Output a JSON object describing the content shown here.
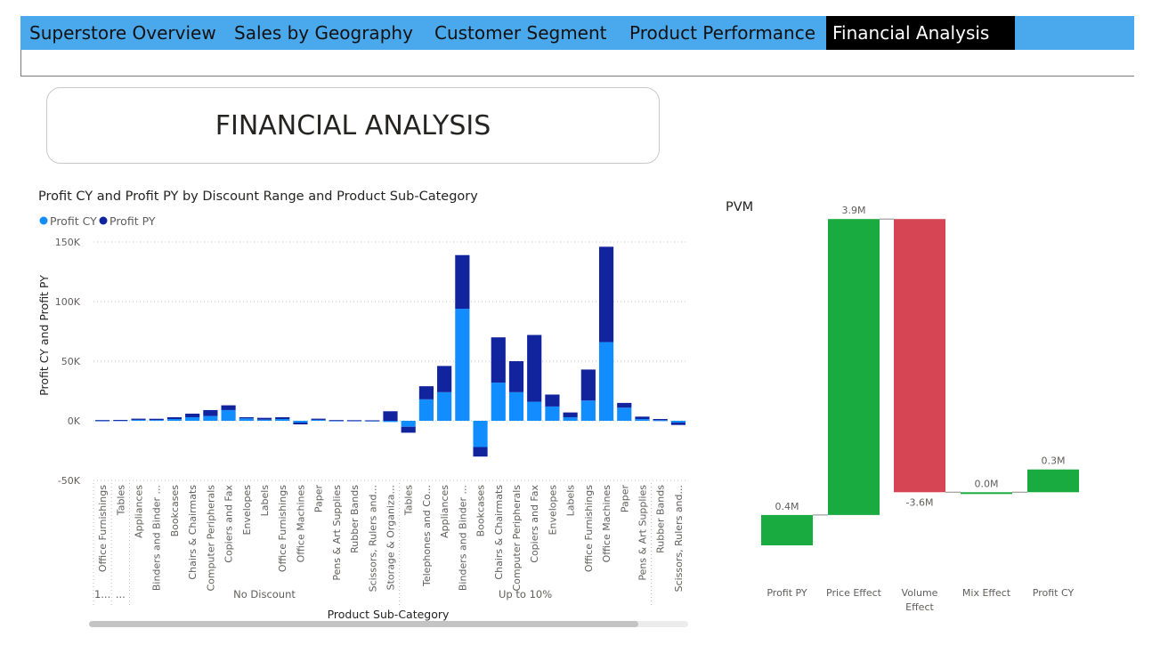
{
  "nav": {
    "tabs": [
      {
        "label": "Superstore Overview",
        "active": false
      },
      {
        "label": "Sales by Geography",
        "active": false
      },
      {
        "label": "Customer Segment",
        "active": false
      },
      {
        "label": "Product Performance",
        "active": false
      },
      {
        "label": "Financial Analysis",
        "active": true
      }
    ]
  },
  "page_title": "FINANCIAL ANALYSIS",
  "colors": {
    "nav_bg": "#4aa8ec",
    "profit_cy": "#118dff",
    "profit_py": "#12239e",
    "increase": "#1aab40",
    "decrease": "#d64554"
  },
  "chart_data": [
    {
      "type": "bar",
      "stacked": true,
      "title": "Profit CY and Profit PY by Discount Range and Product Sub-Category",
      "xlabel": "Product Sub-Category",
      "ylabel": "Profit CY and Profit PY",
      "ylim": [
        -50000,
        150000
      ],
      "yticks": [
        {
          "value": -50000,
          "label": "-50K"
        },
        {
          "value": 0,
          "label": "0K"
        },
        {
          "value": 50000,
          "label": "50K"
        },
        {
          "value": 100000,
          "label": "100K"
        },
        {
          "value": 150000,
          "label": "150K"
        }
      ],
      "grid": true,
      "legend_position": "top-left",
      "groups": [
        {
          "label": "1...",
          "count": 1
        },
        {
          "label": "...",
          "count": 1
        },
        {
          "label": "No Discount",
          "count": 15
        },
        {
          "label": "Up to 10%",
          "count": 14
        }
      ],
      "categories": [
        "Office Furnishings",
        "Tables",
        "Appliances",
        "Binders and Binder ...",
        "Bookcases",
        "Chairs & Chairmats",
        "Computer Peripherals",
        "Copiers and Fax",
        "Envelopes",
        "Labels",
        "Office Furnishings",
        "Office Machines",
        "Paper",
        "Pens & Art Supplies",
        "Rubber Bands",
        "Scissors, Rulers and...",
        "Storage & Organiza...",
        "Tables",
        "Telephones and Co...",
        "Appliances",
        "Binders and Binder ...",
        "Bookcases",
        "Chairs & Chairmats",
        "Computer Peripherals",
        "Copiers and Fax",
        "Envelopes",
        "Labels",
        "Office Furnishings",
        "Office Machines",
        "Paper",
        "Pens & Art Supplies",
        "Rubber Bands",
        "Scissors, Rulers and..."
      ],
      "series": [
        {
          "name": "Profit CY",
          "values": [
            300,
            500,
            800,
            700,
            1500,
            3000,
            4000,
            9000,
            2000,
            1000,
            1500,
            -1500,
            800,
            300,
            300,
            200,
            -1000,
            -5000,
            18000,
            24000,
            94000,
            -22000,
            32000,
            24000,
            16000,
            12000,
            3000,
            17000,
            66000,
            11000,
            1500,
            500,
            -1500
          ]
        },
        {
          "name": "Profit PY",
          "values": [
            300,
            200,
            1000,
            1000,
            1500,
            3000,
            5000,
            4000,
            1000,
            1500,
            1500,
            -1500,
            1000,
            300,
            200,
            200,
            8000,
            -5000,
            11000,
            22000,
            45000,
            -8000,
            38000,
            26000,
            56000,
            10000,
            4000,
            26000,
            80000,
            4000,
            2000,
            1000,
            -2000
          ]
        }
      ]
    },
    {
      "type": "bar",
      "subtype": "waterfall",
      "title": "PVM",
      "categories": [
        "Profit PY",
        "Price Effect",
        "Volume Effect",
        "Mix Effect",
        "Profit CY"
      ],
      "values": [
        0.4,
        3.9,
        -3.6,
        0.0,
        0.3
      ],
      "labels": [
        "0.4M",
        "3.9M",
        "-3.6M",
        "0.0M",
        "0.3M"
      ],
      "units": "M"
    }
  ]
}
